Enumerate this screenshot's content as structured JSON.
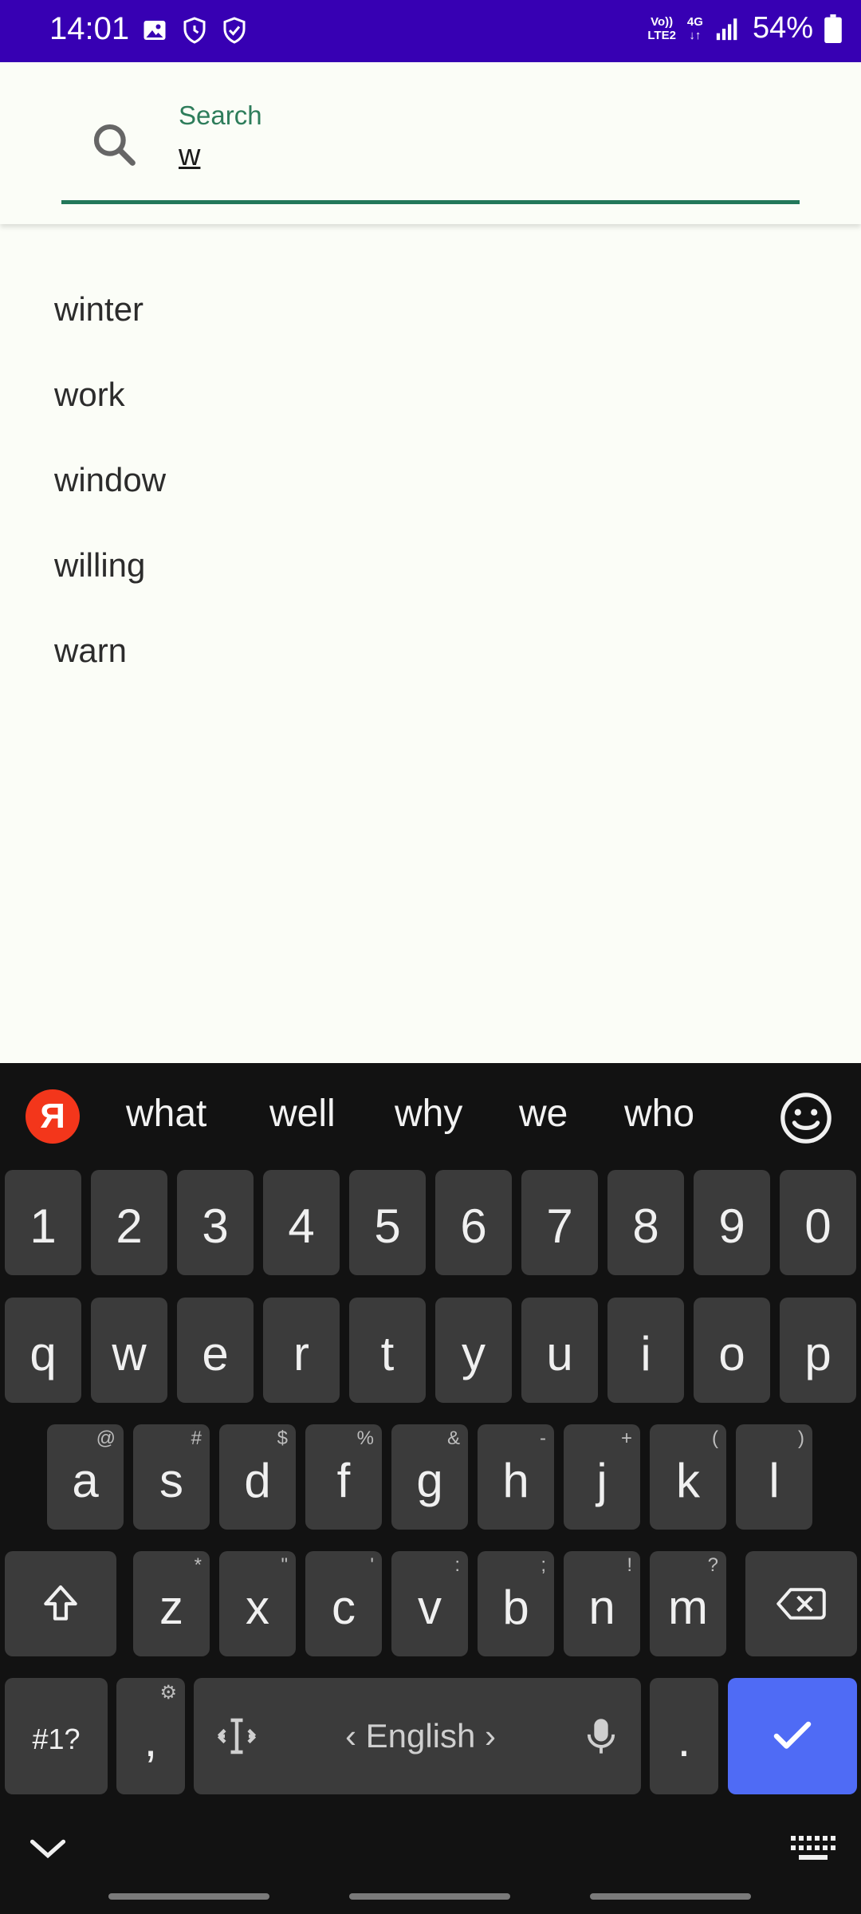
{
  "status_bar": {
    "time": "14:01",
    "network_top": "Vo))",
    "network_bottom": "LTE2",
    "network_type": "4G",
    "battery": "54%"
  },
  "search": {
    "label": "Search",
    "value": "w"
  },
  "results": [
    "winter",
    "work",
    "window",
    "willing",
    "warn"
  ],
  "keyboard": {
    "logo_letter": "Я",
    "suggestions": [
      "what",
      "well",
      "why",
      "we",
      "who"
    ],
    "number_row": [
      "1",
      "2",
      "3",
      "4",
      "5",
      "6",
      "7",
      "8",
      "9",
      "0"
    ],
    "row1": [
      "q",
      "w",
      "e",
      "r",
      "t",
      "y",
      "u",
      "i",
      "o",
      "p"
    ],
    "row2": [
      {
        "key": "a",
        "hint": "@"
      },
      {
        "key": "s",
        "hint": "#"
      },
      {
        "key": "d",
        "hint": "$"
      },
      {
        "key": "f",
        "hint": "%"
      },
      {
        "key": "g",
        "hint": "&"
      },
      {
        "key": "h",
        "hint": "-"
      },
      {
        "key": "j",
        "hint": "+"
      },
      {
        "key": "k",
        "hint": "("
      },
      {
        "key": "l",
        "hint": ")"
      }
    ],
    "row3": [
      {
        "key": "z",
        "hint": "*"
      },
      {
        "key": "x",
        "hint": "\""
      },
      {
        "key": "c",
        "hint": "'"
      },
      {
        "key": "v",
        "hint": ":"
      },
      {
        "key": "b",
        "hint": ";"
      },
      {
        "key": "n",
        "hint": "!"
      },
      {
        "key": "m",
        "hint": "?"
      }
    ],
    "symbols_key": "#1?",
    "comma_key": ",",
    "language": "English",
    "period_key": "."
  }
}
